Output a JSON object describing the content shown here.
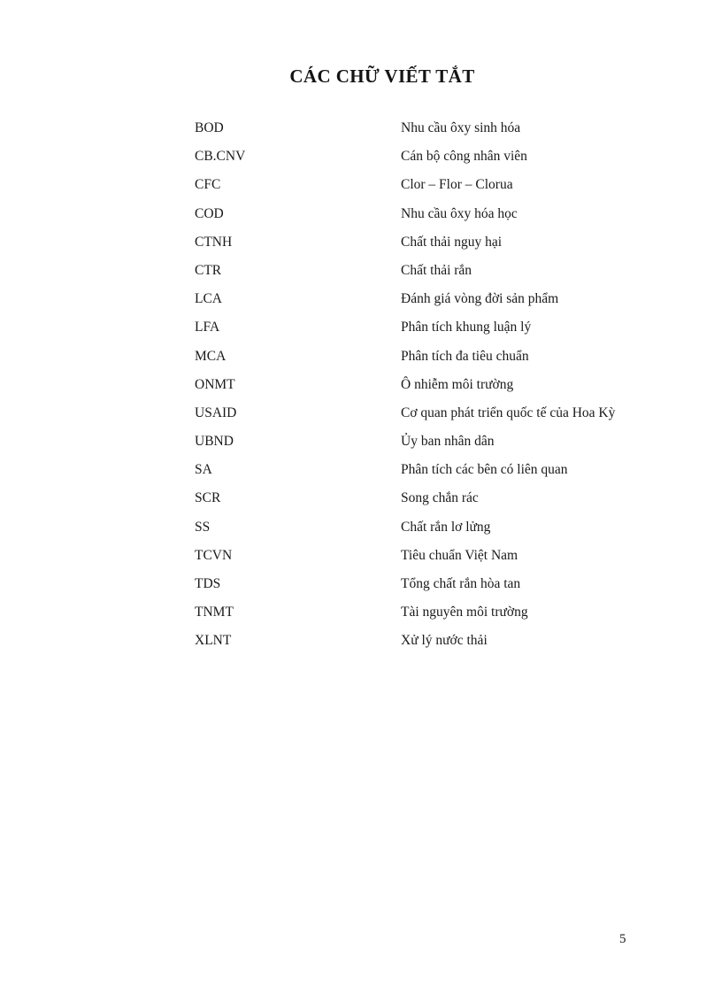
{
  "document": {
    "title": "CÁC CHỮ VIẾT TẮT",
    "page_number": "5",
    "abbreviations": [
      {
        "term": "BOD",
        "definition": "Nhu cầu ôxy sinh hóa"
      },
      {
        "term": "CB.CNV",
        "definition": "Cán bộ công nhân viên"
      },
      {
        "term": "CFC",
        "definition": "Clor – Flor – Clorua"
      },
      {
        "term": "COD",
        "definition": "Nhu cầu ôxy hóa học"
      },
      {
        "term": "CTNH",
        "definition": "Chất thải nguy hại"
      },
      {
        "term": "CTR",
        "definition": "Chất thải rắn"
      },
      {
        "term": "LCA",
        "definition": "Đánh giá vòng đời sản phẩm"
      },
      {
        "term": "LFA",
        "definition": "Phân tích khung luận lý"
      },
      {
        "term": "MCA",
        "definition": "Phân tích đa tiêu chuẩn"
      },
      {
        "term": "ONMT",
        "definition": "Ô nhiễm môi trường"
      },
      {
        "term": "USAID",
        "definition": "Cơ quan phát triển quốc tế của Hoa Kỳ"
      },
      {
        "term": "UBND",
        "definition": "Ủy ban nhân dân"
      },
      {
        "term": "SA",
        "definition": "Phân tích các bên có liên quan"
      },
      {
        "term": "SCR",
        "definition": "Song chắn rác"
      },
      {
        "term": "SS",
        "definition": "Chất rắn lơ lửng"
      },
      {
        "term": "TCVN",
        "definition": "Tiêu chuẩn Việt Nam"
      },
      {
        "term": "TDS",
        "definition": "Tổng chất rắn hòa tan"
      },
      {
        "term": "TNMT",
        "definition": "Tài nguyên môi trường"
      },
      {
        "term": "XLNT",
        "definition": "Xử lý nước thải"
      }
    ]
  }
}
